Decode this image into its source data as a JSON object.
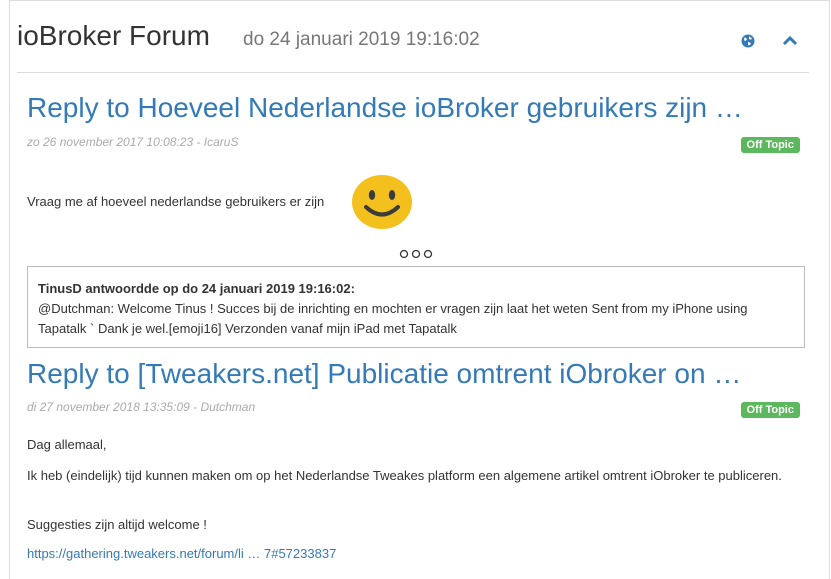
{
  "header": {
    "title": "ioBroker Forum",
    "date": "do 24 januari 2019 19:16:02"
  },
  "posts": [
    {
      "title": "Reply to Hoeveel Nederlandse ioBroker gebruikers zijn …",
      "meta": "zo 26 november 2017 10:08:23 - IcaruS",
      "badge": "Off Topic",
      "body": "Vraag me af hoeveel nederlandse gebruikers er zijn",
      "quote": {
        "head": "TinusD antwoordde op do 24 januari 2019 19:16:02:",
        "text": "@Dutchman: Welcome Tinus ! Succes bij de inrichting en mochten er vragen zijn laat het weten Sent from my iPhone using Tapatalk ` Dank je wel.[emoji16] Verzonden vanaf mijn iPad met Tapatalk"
      }
    },
    {
      "title": "Reply to [Tweakers.net] Publicatie omtrent iObroker on …",
      "meta": "di 27 november 2018 13:35:09 - Dutchman",
      "badge": "Off Topic",
      "paragraphs": [
        "Dag allemaal,",
        "Ik heb (eindelijk) tijd kunnen maken om op het Nederlandse Tweakes platform een algemene artikel omtrent iObroker te publiceren.",
        "Suggesties zijn altijd welcome !"
      ],
      "link": "https://gathering.tweakers.net/forum/li … 7#57233837"
    }
  ],
  "icons": {
    "globe": "globe-icon",
    "collapse": "chevron-up-icon",
    "smiley": "smiley-emoji-icon",
    "more": "more-dots-icon"
  },
  "colors": {
    "link": "#337ab7",
    "badge": "#5cb85c",
    "emoji": "#f4c01e"
  }
}
